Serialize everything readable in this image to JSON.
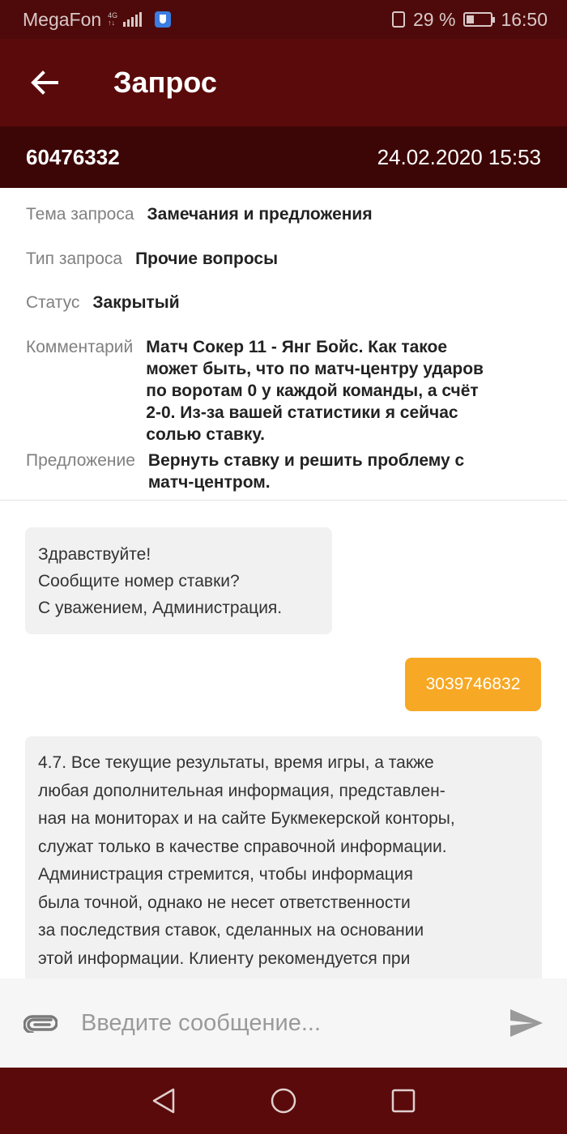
{
  "status_bar": {
    "carrier": "MegaFon",
    "network_top": "4G",
    "network_bottom": "↑↓",
    "battery_percent": "29 %",
    "battery_level": 0.29,
    "time": "16:50"
  },
  "app_bar": {
    "title": "Запрос",
    "back_icon": "arrow-left-icon"
  },
  "request": {
    "id": "60476332",
    "datetime": "24.02.2020 15:53"
  },
  "details": {
    "topic_label": "Тема запроса",
    "topic_value": "Замечания и предложения",
    "type_label": "Тип запроса",
    "type_value": "Прочие вопросы",
    "status_label": "Статус",
    "status_value": "Закрытый",
    "comment_label": "Комментарий",
    "comment_lines": [
      "Матч Сокер 11 - Янг Бойс. Как такое",
      "может быть, что по матч-центру ударов",
      "по воротам 0 у каждой команды, а счёт",
      "2-0. Из-за вашей статистики я сейчас",
      "солью ставку."
    ],
    "proposal_label": "Предложение",
    "proposal_lines": [
      "Вернуть ставку и решить проблему с",
      "матч-центром."
    ]
  },
  "messages": {
    "m1_lines": [
      "Здравствуйте!",
      "Сообщите номер ставки?",
      "С уважением, Администрация."
    ],
    "m2_text": "3039746832",
    "m3_lines": [
      "4.7. Все текущие результаты, время игры, а также",
      "любая дополнительная информация, представлен-",
      "ная на мониторах и на сайте Букмекерской конторы,",
      "служат только в качестве справочной информации.",
      "Администрация стремится, чтобы информация",
      "была точной, однако не несет ответственности",
      "за последствия ставок, сделанных на основании",
      "этой информации. Клиенту рекомендуется при"
    ]
  },
  "composer": {
    "placeholder": "Введите сообщение...",
    "attach_icon": "paperclip-icon",
    "send_icon": "send-icon"
  },
  "colors": {
    "primary_dark": "#5a0a0a",
    "primary_darker": "#3d0606",
    "accent": "#f7a824",
    "bubble_in": "#f1f1f1"
  }
}
